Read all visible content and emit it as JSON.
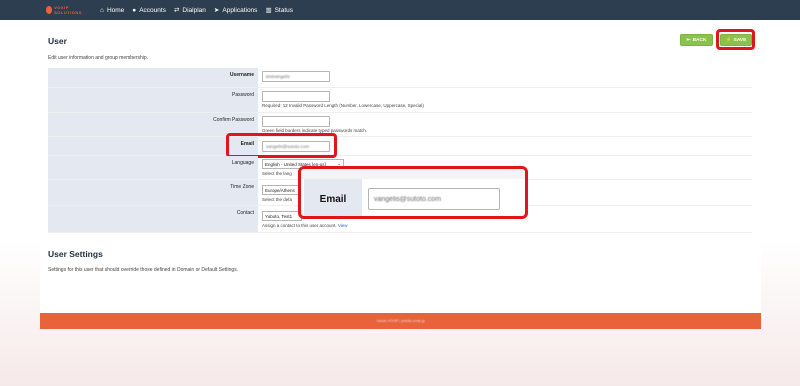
{
  "nav": {
    "logo_text": "VOXIP SOLUTIONS",
    "items": [
      {
        "icon": "home-icon",
        "glyph": "⌂",
        "label": "Home"
      },
      {
        "icon": "user-icon",
        "glyph": "●",
        "label": "Accounts"
      },
      {
        "icon": "transfer-icon",
        "glyph": "⇄",
        "label": "Dialplan"
      },
      {
        "icon": "paper-plane-icon",
        "glyph": "➤",
        "label": "Applications"
      },
      {
        "icon": "chart-icon",
        "glyph": "▥",
        "label": "Status"
      }
    ]
  },
  "header": {
    "title": "User",
    "description": "Edit user information and group membership.",
    "back_label": "BACK",
    "save_label": "SAVE"
  },
  "form": {
    "username": {
      "label": "Username",
      "value": "testvangelis"
    },
    "password": {
      "label": "Password",
      "hint": "Required: 12 Invalid Password Length (Number, Lowercase, Uppercase, Special)"
    },
    "confirm_password": {
      "label": "Confirm Password",
      "hint": "Green field borders indicate typed passwords match."
    },
    "email": {
      "label": "Email",
      "value": "vangelis@sutoto.com"
    },
    "language": {
      "label": "Language",
      "value": "English - United States [en-us]",
      "hint": "Select the language."
    },
    "time_zone": {
      "label": "Time Zone",
      "value": "Europe/Athens",
      "hint": "Select the default time zone."
    },
    "contact": {
      "label": "Contact",
      "value": "Yuboto, Test1",
      "hint": "Assign a contact to this user account.",
      "link": "View"
    }
  },
  "user_settings": {
    "title": "User Settings",
    "description": "Settings for this user that should override those defined in Domain or Default Settings."
  },
  "zoom": {
    "label": "Email",
    "value": "vangelis@sutoto.com"
  },
  "footer": {
    "text": "Yuboto VOXIP | yuboto.voxip.gr"
  },
  "colors": {
    "topbar": "#2c3e50",
    "accent": "#e8623c",
    "button": "#8bc34a",
    "highlight": "#e0161b",
    "label_bg": "#e4e9f1"
  }
}
